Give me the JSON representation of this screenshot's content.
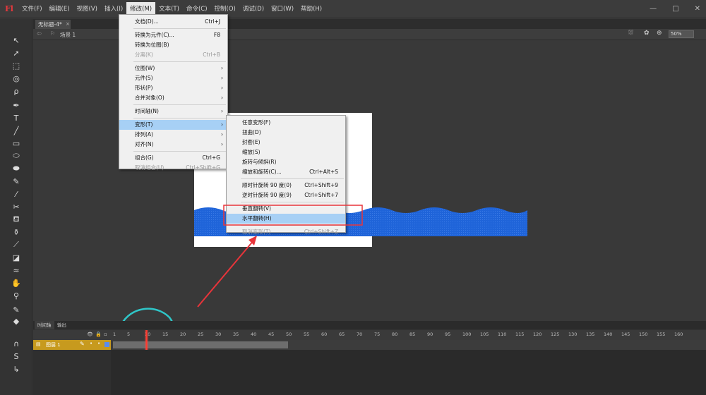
{
  "app": {
    "logo": "Fl"
  },
  "menubar": {
    "items": [
      "文件(F)",
      "编辑(E)",
      "视图(V)",
      "插入(I)",
      "修改(M)",
      "文本(T)",
      "命令(C)",
      "控制(O)",
      "调试(D)",
      "窗口(W)",
      "帮助(H)"
    ],
    "active_index": 4,
    "window_controls": [
      "—",
      "□",
      "✕"
    ]
  },
  "document": {
    "tab_label": "无标题-4*",
    "tab_close": "×",
    "scene_label": "场景 1",
    "zoom": "50%"
  },
  "modify_menu": {
    "items": [
      {
        "label": "文档(D)...",
        "shortcut": "Ctrl+J"
      },
      {
        "sep": true
      },
      {
        "label": "转换为元件(C)...",
        "shortcut": "F8"
      },
      {
        "label": "转换为位图(B)",
        "shortcut": ""
      },
      {
        "label": "分离(K)",
        "shortcut": "Ctrl+B",
        "disabled": true
      },
      {
        "sep": true
      },
      {
        "label": "位图(W)",
        "submenu": true
      },
      {
        "label": "元件(S)",
        "submenu": true
      },
      {
        "label": "形状(P)",
        "submenu": true
      },
      {
        "label": "合并对象(O)",
        "submenu": true
      },
      {
        "sep": true
      },
      {
        "label": "时间轴(N)",
        "submenu": true
      },
      {
        "sep": true
      },
      {
        "label": "变形(T)",
        "submenu": true,
        "highlighted": true
      },
      {
        "label": "排列(A)",
        "submenu": true
      },
      {
        "label": "对齐(N)",
        "submenu": true
      },
      {
        "sep": true
      },
      {
        "label": "组合(G)",
        "shortcut": "Ctrl+G"
      },
      {
        "label": "取消组合(U)",
        "shortcut": "Ctrl+Shift+G",
        "disabled": true
      }
    ]
  },
  "transform_menu": {
    "items": [
      {
        "label": "任意变形(F)"
      },
      {
        "label": "扭曲(D)"
      },
      {
        "label": "封套(E)"
      },
      {
        "label": "缩放(S)"
      },
      {
        "label": "旋转与倾斜(R)"
      },
      {
        "label": "缩放和旋转(C)...",
        "shortcut": "Ctrl+Alt+S"
      },
      {
        "sep": true
      },
      {
        "label": "顺时针旋转 90 度(0)",
        "shortcut": "Ctrl+Shift+9"
      },
      {
        "label": "逆时针旋转 90 度(9)",
        "shortcut": "Ctrl+Shift+7"
      },
      {
        "sep": true
      },
      {
        "label": "垂直翻转(V)"
      },
      {
        "label": "水平翻转(H)",
        "highlighted": true
      },
      {
        "sep": true
      },
      {
        "label": "取消变形(T)",
        "shortcut": "Ctrl+Shift+Z",
        "disabled": true
      }
    ]
  },
  "timeline": {
    "tabs": [
      "时间轴",
      "输出"
    ],
    "frame_numbers": [
      "1",
      "5",
      "10",
      "15",
      "20",
      "25",
      "30",
      "35",
      "40",
      "45",
      "50",
      "55",
      "60",
      "65",
      "70",
      "75",
      "80",
      "85",
      "90",
      "95",
      "100",
      "105",
      "110",
      "115",
      "120",
      "125",
      "130",
      "135",
      "140",
      "145",
      "150",
      "155",
      "160"
    ],
    "layer_name": "图层 1",
    "current_frame": 10,
    "last_keyframe": 50
  },
  "colors": {
    "accent_highlight": "#a7d0f5",
    "wave_blue": "#1e63d8",
    "layer_gold": "#c79a1e",
    "annotation_red": "#e8343a",
    "annotation_cyan": "#2fc6c8"
  }
}
